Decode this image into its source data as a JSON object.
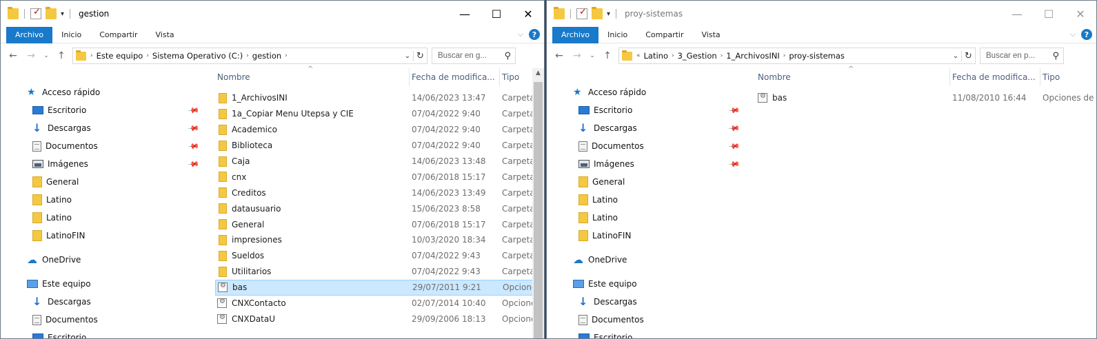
{
  "left": {
    "title": "gestion",
    "tabs": {
      "file": "Archivo",
      "home": "Inicio",
      "share": "Compartir",
      "view": "Vista"
    },
    "breadcrumb": [
      "Este equipo",
      "Sistema Operativo (C:)",
      "gestion"
    ],
    "search_placeholder": "Buscar en g...",
    "columns": {
      "name": "Nombre",
      "date": "Fecha de modifica...",
      "type": "Tipo"
    },
    "nav": {
      "quick_access": "Acceso rápido",
      "pinned": [
        "Escritorio",
        "Descargas",
        "Documentos",
        "Imágenes"
      ],
      "folders": [
        "General",
        "Latino",
        "Latino",
        "LatinoFIN"
      ],
      "onedrive": "OneDrive",
      "this_pc": "Este equipo",
      "pc_items": [
        "Descargas",
        "Documentos",
        "Escritorio"
      ]
    },
    "files": [
      {
        "name": "1_ArchivosINI",
        "date": "14/06/2023 13:47",
        "type": "Carpeta",
        "kind": "folder"
      },
      {
        "name": "1a_Copiar Menu Utepsa y CIE",
        "date": "07/04/2022 9:40",
        "type": "Carpeta",
        "kind": "folder"
      },
      {
        "name": "Academico",
        "date": "07/04/2022 9:40",
        "type": "Carpeta",
        "kind": "folder"
      },
      {
        "name": "Biblioteca",
        "date": "07/04/2022 9:40",
        "type": "Carpeta",
        "kind": "folder"
      },
      {
        "name": "Caja",
        "date": "14/06/2023 13:48",
        "type": "Carpeta",
        "kind": "folder"
      },
      {
        "name": "cnx",
        "date": "07/06/2018 15:17",
        "type": "Carpeta",
        "kind": "folder"
      },
      {
        "name": "Creditos",
        "date": "14/06/2023 13:49",
        "type": "Carpeta",
        "kind": "folder"
      },
      {
        "name": "datausuario",
        "date": "15/06/2023 8:58",
        "type": "Carpeta",
        "kind": "folder"
      },
      {
        "name": "General",
        "date": "07/06/2018 15:17",
        "type": "Carpeta",
        "kind": "folder"
      },
      {
        "name": "impresiones",
        "date": "10/03/2020 18:34",
        "type": "Carpeta",
        "kind": "folder"
      },
      {
        "name": "Sueldos",
        "date": "07/04/2022 9:43",
        "type": "Carpeta",
        "kind": "folder"
      },
      {
        "name": "Utilitarios",
        "date": "07/04/2022 9:43",
        "type": "Carpeta",
        "kind": "folder"
      },
      {
        "name": "bas",
        "date": "29/07/2011 9:21",
        "type": "Opciones",
        "kind": "file",
        "selected": true
      },
      {
        "name": "CNXContacto",
        "date": "02/07/2014 10:40",
        "type": "Opciones",
        "kind": "file"
      },
      {
        "name": "CNXDataU",
        "date": "29/09/2006 18:13",
        "type": "Opciones",
        "kind": "file"
      }
    ]
  },
  "right": {
    "title": "proy-sistemas",
    "tabs": {
      "file": "Archivo",
      "home": "Inicio",
      "share": "Compartir",
      "view": "Vista"
    },
    "breadcrumb_prefix": "«",
    "breadcrumb": [
      "Latino",
      "3_Gestion",
      "1_ArchivosINI",
      "proy-sistemas"
    ],
    "search_placeholder": "Buscar en p...",
    "columns": {
      "name": "Nombre",
      "date": "Fecha de modifica...",
      "type": "Tipo"
    },
    "nav": {
      "quick_access": "Acceso rápido",
      "pinned": [
        "Escritorio",
        "Descargas",
        "Documentos",
        "Imágenes"
      ],
      "folders": [
        "General",
        "Latino",
        "Latino",
        "LatinoFIN"
      ],
      "onedrive": "OneDrive",
      "this_pc": "Este equipo",
      "pc_items": [
        "Descargas",
        "Documentos",
        "Escritorio"
      ]
    },
    "files": [
      {
        "name": "bas",
        "date": "11/08/2010 16:44",
        "type": "Opciones de configuración",
        "kind": "file"
      }
    ]
  },
  "icons": {
    "minimize": "minimize-icon",
    "maximize": "maximize-icon",
    "close": "close-icon",
    "back": "back-arrow-icon",
    "forward": "forward-arrow-icon",
    "up": "up-arrow-icon",
    "refresh": "refresh-icon",
    "search": "search-icon",
    "help": "help-icon",
    "pin": "pin-icon"
  },
  "colors": {
    "accent": "#1979ca",
    "selection": "#cce8ff",
    "folder": "#f5c842"
  }
}
